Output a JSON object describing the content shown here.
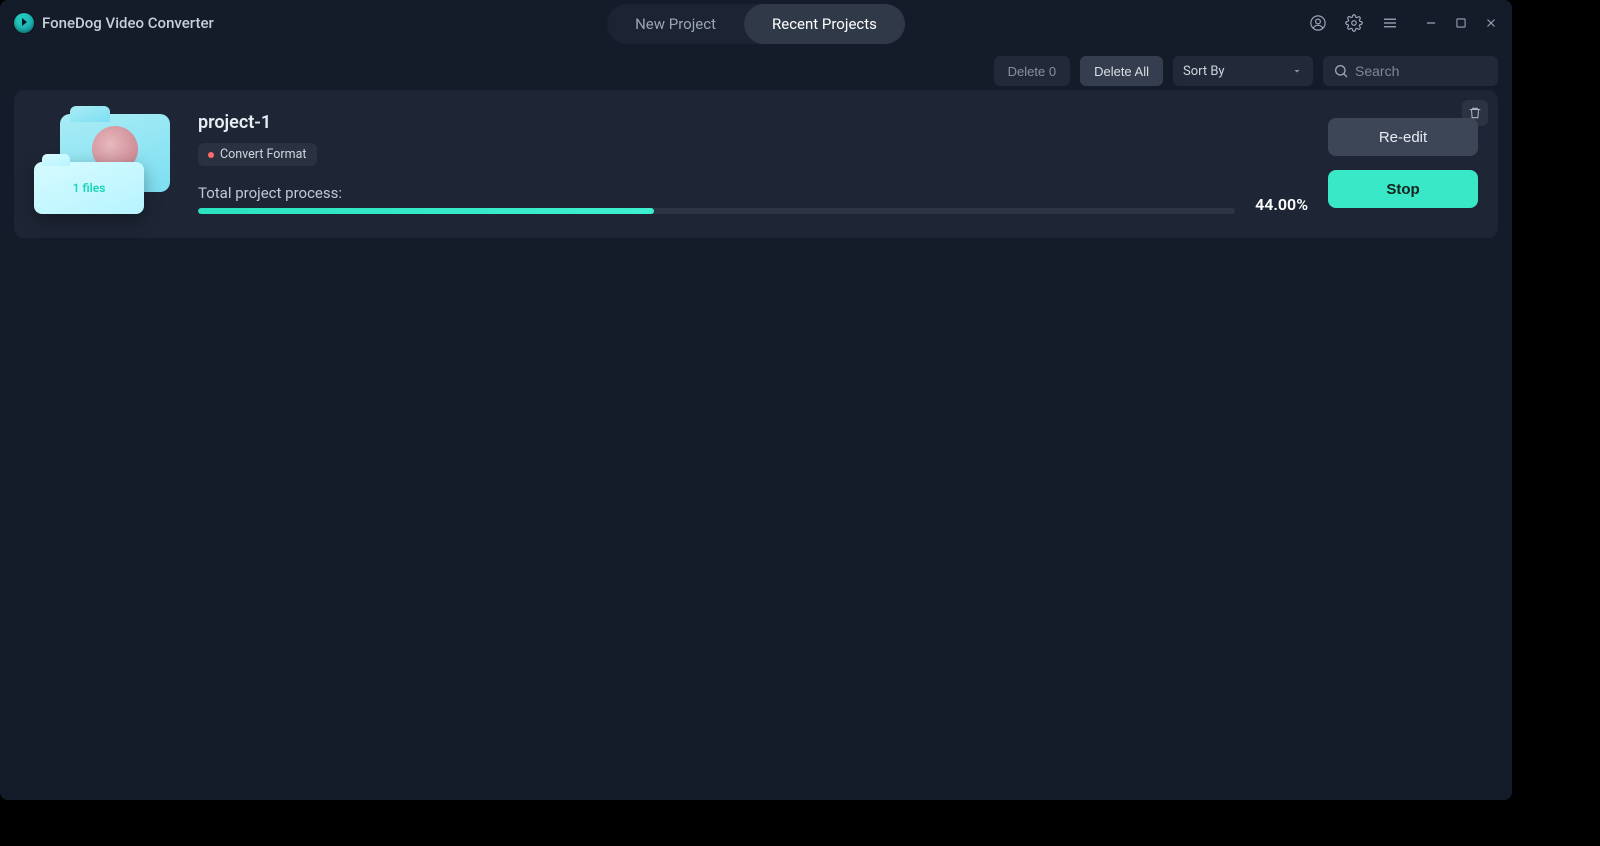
{
  "app": {
    "title": "FoneDog Video Converter"
  },
  "tabs": {
    "new": "New Project",
    "recent": "Recent Projects"
  },
  "toolbar": {
    "delete_zero": "Delete 0",
    "delete_all": "Delete All",
    "sort_label": "Sort By",
    "search_placeholder": "Search"
  },
  "project": {
    "name": "project-1",
    "tag": "Convert Format",
    "files_label": "1 files",
    "progress_label": "Total project process:",
    "percent_text": "44.00%",
    "percent_css_width": "44%",
    "reedit_label": "Re-edit",
    "stop_label": "Stop"
  }
}
